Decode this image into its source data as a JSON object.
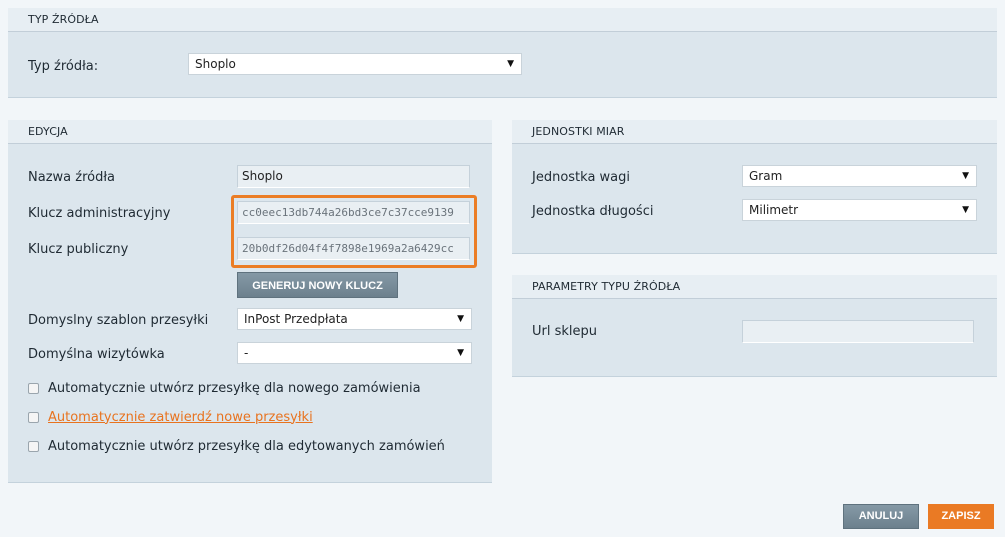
{
  "source_type_panel": {
    "header": "TYP ŹRÓDŁA",
    "label": "Typ źródła:",
    "selected": "Shoplo"
  },
  "edit_panel": {
    "header": "EDYCJA",
    "name_label": "Nazwa źródła",
    "name_value": "Shoplo",
    "admin_key_label": "Klucz administracyjny",
    "admin_key_value": "cc0eec13db744a26bd3ce7c37cce9139",
    "public_key_label": "Klucz publiczny",
    "public_key_value": "20b0df26d04f4f7898e1969a2a6429cc",
    "generate_button": "GENERUJ NOWY KLUCZ",
    "template_label": "Domyslny szablon przesyłki",
    "template_selected": "InPost Przedpłata",
    "business_card_label": "Domyślna wizytówka",
    "business_card_selected": "-",
    "checkboxes": [
      {
        "label": "Automatycznie utwórz przesyłkę dla nowego zamówienia",
        "checked": false,
        "link": false
      },
      {
        "label": "Automatycznie zatwierdź nowe przesyłki",
        "checked": false,
        "link": true
      },
      {
        "label": "Automatycznie utwórz przesyłkę dla edytowanych zamówień",
        "checked": false,
        "link": false
      }
    ]
  },
  "units_panel": {
    "header": "JEDNOSTKI MIAR",
    "weight_label": "Jednostka wagi",
    "weight_selected": "Gram",
    "length_label": "Jednostka długości",
    "length_selected": "Milimetr"
  },
  "params_panel": {
    "header": "PARAMETRY TYPU ŹRÓDŁA",
    "url_label": "Url sklepu",
    "url_value": ""
  },
  "footer": {
    "cancel_label": "ANULUJ",
    "save_label": "ZAPISZ"
  },
  "colors": {
    "accent": "#ea7a24",
    "button_gray": "#7a8e9b",
    "panel_bg": "#dce6ed"
  }
}
